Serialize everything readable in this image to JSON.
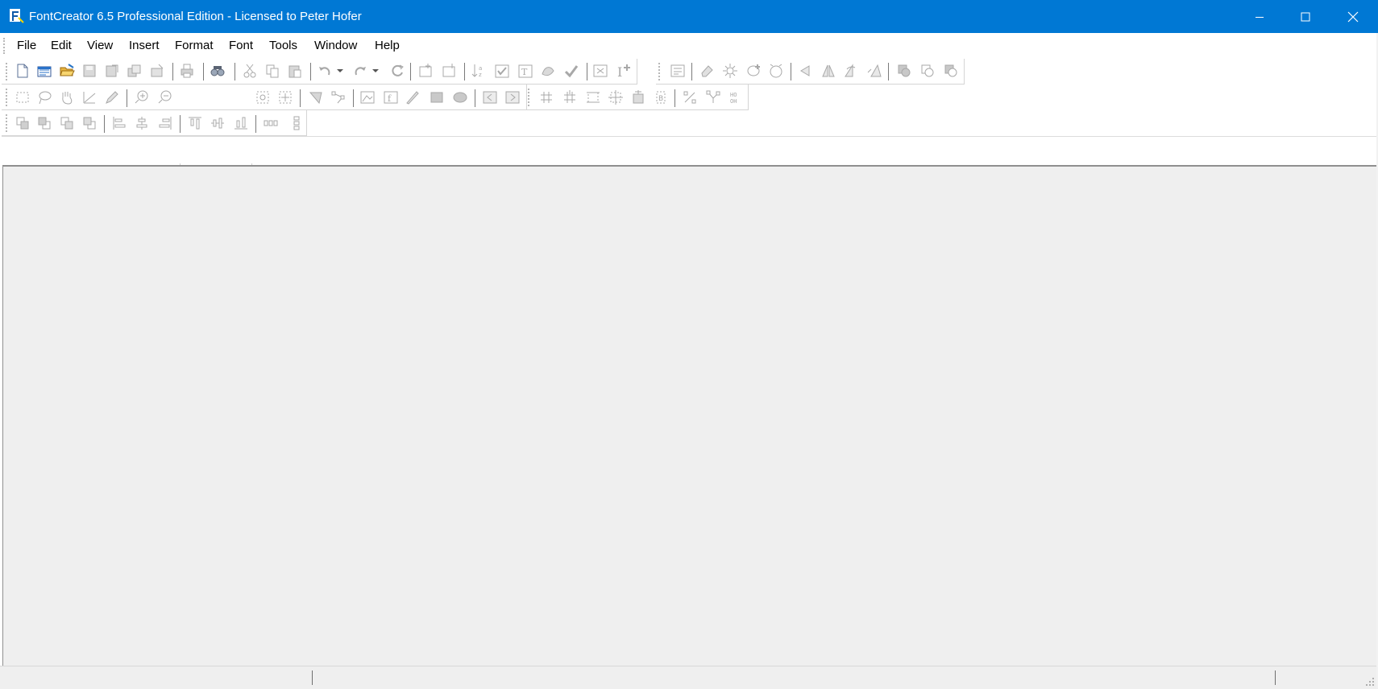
{
  "window": {
    "title": "FontCreator 6.5 Professional Edition - Licensed to Peter Hofer",
    "icons": [
      "app-icon",
      "minimize-icon",
      "maximize-icon",
      "close-icon"
    ]
  },
  "menu": {
    "items": [
      "File",
      "Edit",
      "View",
      "Insert",
      "Format",
      "Font",
      "Tools",
      "Window",
      "Help"
    ]
  },
  "toolbars": {
    "standard": [
      "new-font-icon",
      "new-font-list-icon",
      "open-folder-icon",
      "save-icon",
      "save-as-icon",
      "save-all-icon",
      "close-font-icon",
      "print-icon",
      "find-icon",
      "cut-icon",
      "copy-icon",
      "paste-icon",
      "undo-icon",
      "undo-dropdown-icon",
      "redo-icon",
      "redo-dropdown-icon",
      "refresh-icon",
      "insert-glyph-icon",
      "insert-character-icon",
      "sort-icon",
      "validate-icon",
      "test-font-icon",
      "transform-icon",
      "check-icon",
      "preview-icon",
      "insert-text-icon"
    ],
    "font_tools": [
      "properties-icon",
      "eraser-icon",
      "auto-hint-icon",
      "add-node-icon",
      "smooth-icon",
      "flip-horizontal-icon",
      "mirror-icon",
      "rotate-icon",
      "skew-icon",
      "union-icon",
      "intersect-icon",
      "subtract-icon"
    ],
    "drawing": [
      "select-rect-icon",
      "lasso-icon",
      "hand-icon",
      "measure-icon",
      "pen-icon",
      "zoom-in-icon",
      "zoom-out-icon",
      "zoom-select-icon",
      "fit-window-icon",
      "fit-glyph-icon",
      "triangle-tool-icon",
      "node-tool-icon",
      "image-icon",
      "function-icon",
      "pencil-icon",
      "rectangle-icon",
      "ellipse-icon",
      "previous-glyph-icon",
      "next-glyph-icon"
    ],
    "grid": [
      "grid-icon",
      "grid-add-icon",
      "guidelines-icon",
      "bounding-box-icon",
      "anchor-icon",
      "baseline-icon",
      "percent-icon",
      "connect-icon",
      "metrics-icon"
    ],
    "arrange": [
      "bring-front-icon",
      "bring-forward-icon",
      "send-backward-icon",
      "send-back-icon",
      "align-left-icon",
      "align-center-icon",
      "align-right-icon",
      "align-top-icon",
      "align-middle-icon",
      "align-bottom-icon",
      "distribute-horizontal-icon",
      "distribute-vertical-icon"
    ],
    "zoom_value": ""
  },
  "status": {
    "panels": [
      "",
      "",
      ""
    ]
  },
  "colors": {
    "titlebar": "#0078d4",
    "workspace": "#efefef",
    "icon_disabled": "#a8a8a8"
  }
}
